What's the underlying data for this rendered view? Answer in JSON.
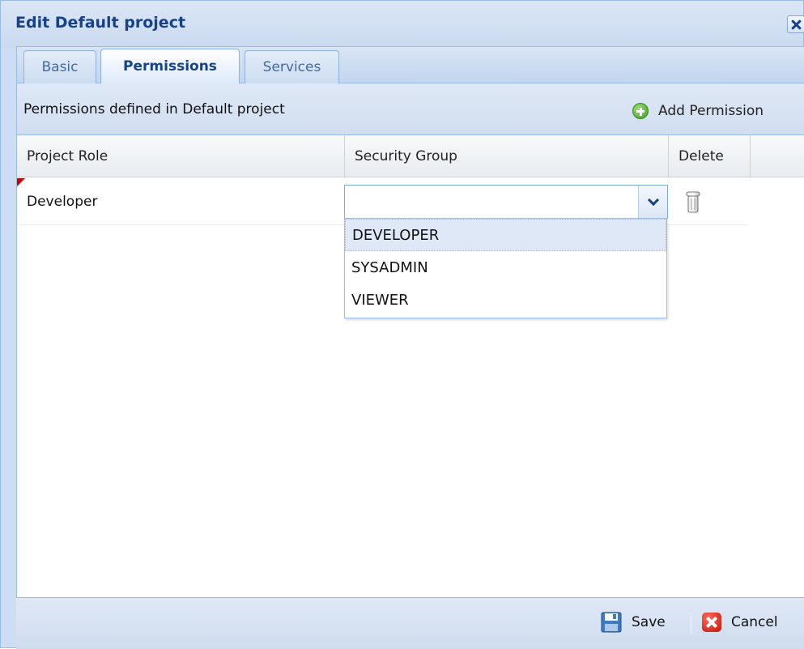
{
  "window": {
    "title": "Edit Default project",
    "close_icon": "close-icon"
  },
  "tabs": [
    {
      "label": "Basic",
      "active": false
    },
    {
      "label": "Permissions",
      "active": true
    },
    {
      "label": "Services",
      "active": false
    }
  ],
  "toolbar": {
    "description": "Permissions defined in Default project",
    "add_label": "Add Permission",
    "add_icon": "add-icon"
  },
  "grid": {
    "columns": [
      "Project Role",
      "Security Group",
      "Delete",
      ""
    ],
    "rows": [
      {
        "role": "Developer",
        "security_group": "",
        "dirty": true
      }
    ]
  },
  "security_group_dropdown": {
    "options": [
      "DEVELOPER",
      "SYSADMIN",
      "VIEWER"
    ],
    "highlighted": "DEVELOPER"
  },
  "footer": {
    "save_label": "Save",
    "cancel_label": "Cancel",
    "save_icon": "save-icon",
    "cancel_icon": "cancel-icon"
  },
  "colors": {
    "title_text": "#15428b",
    "window_bg": "#cedef2",
    "border": "#99bbe8",
    "add_icon_green": "#3e9a1e",
    "cancel_icon_red": "#c3140a",
    "dirty_flag": "#cc0000"
  }
}
